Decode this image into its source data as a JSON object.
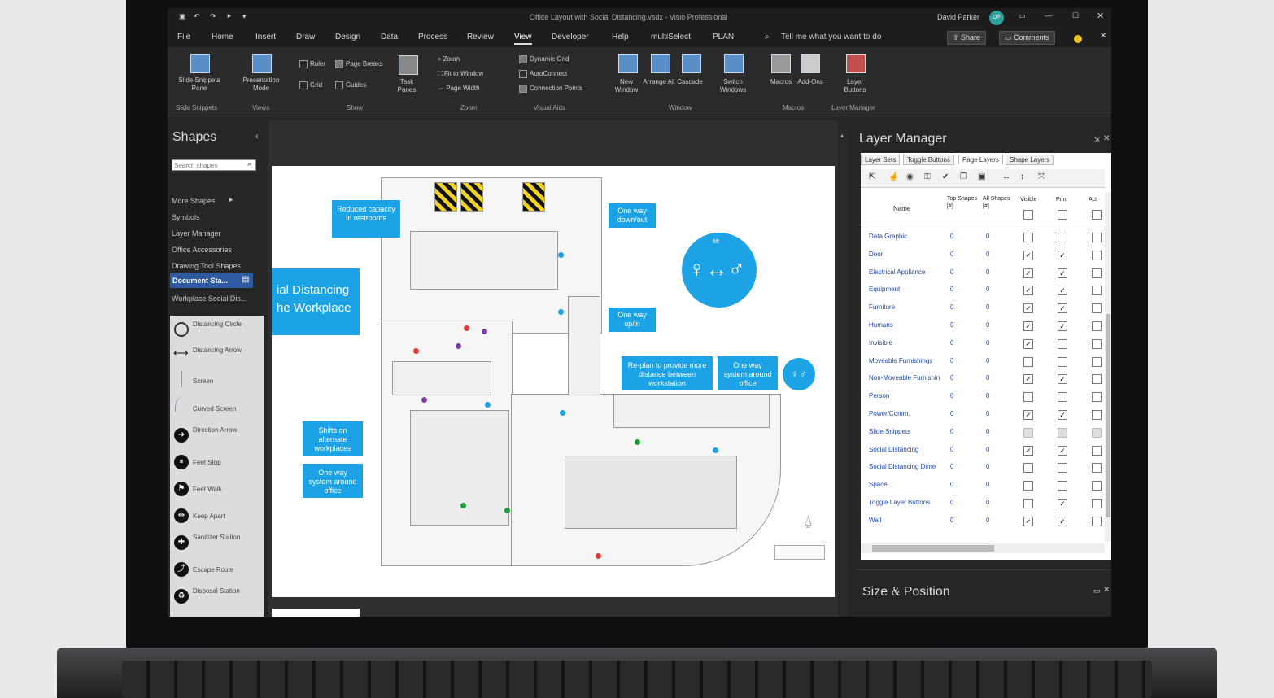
{
  "window": {
    "title": "Office Layout with Social Distancing.vsdx  -  Visio Professional",
    "user": "David Parker",
    "user_initials": "DP"
  },
  "tabs": [
    "File",
    "Home",
    "Insert",
    "Draw",
    "Design",
    "Data",
    "Process",
    "Review",
    "View",
    "Developer",
    "Help",
    "multiSelect",
    "PLAN"
  ],
  "active_tab": "View",
  "tell_me": "Tell me what you want to do",
  "share_label": "Share",
  "comments_label": "Comments",
  "ribbon": {
    "slide_snippets": {
      "button": "Slide Snippets Pane",
      "group": "Slide Snippets"
    },
    "views": {
      "button": "Presentation Mode",
      "group": "Views"
    },
    "show": {
      "ruler": "Ruler",
      "page_breaks": "Page Breaks",
      "grid": "Grid",
      "guides": "Guides",
      "task_panes": "Task Panes",
      "group": "Show"
    },
    "zoom": {
      "zoom": "Zoom",
      "fit": "Fit to Window",
      "page_width": "Page Width",
      "group": "Zoom"
    },
    "visual_aids": {
      "dynamic_grid": "Dynamic Grid",
      "autoconnect": "AutoConnect",
      "connection_points": "Connection Points",
      "group": "Visual Aids"
    },
    "window": {
      "new_window": "New Window",
      "arrange_all": "Arrange All",
      "cascade": "Cascade",
      "switch_windows": "Switch Windows",
      "group": "Window"
    },
    "macros": {
      "macros": "Macros",
      "addons": "Add-Ons",
      "group": "Macros"
    },
    "layer_manager": {
      "button": "Layer Buttons",
      "group": "Layer Manager"
    }
  },
  "shapes_panel": {
    "title": "Shapes",
    "search_placeholder": "Search shapes",
    "items": [
      "More Shapes",
      "Symbols",
      "Layer Manager",
      "Office Accessories",
      "Drawing Tool Shapes",
      "Document Sta...",
      "Workplace Social Dis..."
    ],
    "stencil": [
      "Distancing Circle",
      "Distancing Arrow",
      "Screen",
      "Curved Screen",
      "Direction Arrow",
      "Feet Stop",
      "Feet Walk",
      "Keep Apart",
      "Sanitizer Station",
      "Escape Route",
      "Disposal Station"
    ]
  },
  "canvas": {
    "banner": "ial Distancing\nhe Workplace",
    "callouts": [
      "Reduced capacity in restrooms",
      "One way down/out",
      "One way up/in",
      "Re-plan to provide more distance between workstation",
      "One way system around office",
      "Shifts on alternate workplaces",
      "One way system around office"
    ],
    "distance_label": "6ft"
  },
  "layer_manager": {
    "title": "Layer Manager",
    "tabs": [
      "Layer Sets",
      "Toggle Buttons",
      "Page Layers",
      "Shape Layers"
    ],
    "active_tab": "Page Layers",
    "columns": [
      "Name",
      "Top Shapes [#]",
      "All Shapes [#]",
      "Visible",
      "Print",
      "Act"
    ],
    "rows": [
      {
        "name": "Data Graphic",
        "top": "0",
        "all": "0",
        "visible": false,
        "print": false
      },
      {
        "name": "Door",
        "top": "0",
        "all": "0",
        "visible": true,
        "print": true
      },
      {
        "name": "Electrical Appliance",
        "top": "0",
        "all": "0",
        "visible": true,
        "print": true
      },
      {
        "name": "Equipment",
        "top": "0",
        "all": "0",
        "visible": true,
        "print": true
      },
      {
        "name": "Furniture",
        "top": "0",
        "all": "0",
        "visible": true,
        "print": true
      },
      {
        "name": "Humans",
        "top": "0",
        "all": "0",
        "visible": true,
        "print": true
      },
      {
        "name": "Invisible",
        "top": "0",
        "all": "0",
        "visible": true,
        "print": false
      },
      {
        "name": "Moveable Furnishings",
        "top": "0",
        "all": "0",
        "visible": false,
        "print": false
      },
      {
        "name": "Non-Moveable Furnishin",
        "top": "0",
        "all": "0",
        "visible": true,
        "print": true
      },
      {
        "name": "Person",
        "top": "0",
        "all": "0",
        "visible": false,
        "print": false
      },
      {
        "name": "Power/Comm.",
        "top": "0",
        "all": "0",
        "visible": true,
        "print": true
      },
      {
        "name": "Slide Snippets",
        "top": "0",
        "all": "0",
        "visible": null,
        "print": null
      },
      {
        "name": "Social Distancing",
        "top": "0",
        "all": "0",
        "visible": true,
        "print": true
      },
      {
        "name": "Social Distancing Dime",
        "top": "0",
        "all": "0",
        "visible": false,
        "print": false
      },
      {
        "name": "Space",
        "top": "0",
        "all": "0",
        "visible": false,
        "print": false
      },
      {
        "name": "Toggle Layer Buttons",
        "top": "0",
        "all": "0",
        "visible": false,
        "print": true
      },
      {
        "name": "Wall",
        "top": "0",
        "all": "0",
        "visible": true,
        "print": true
      }
    ]
  },
  "size_position": {
    "title": "Size & Position"
  }
}
